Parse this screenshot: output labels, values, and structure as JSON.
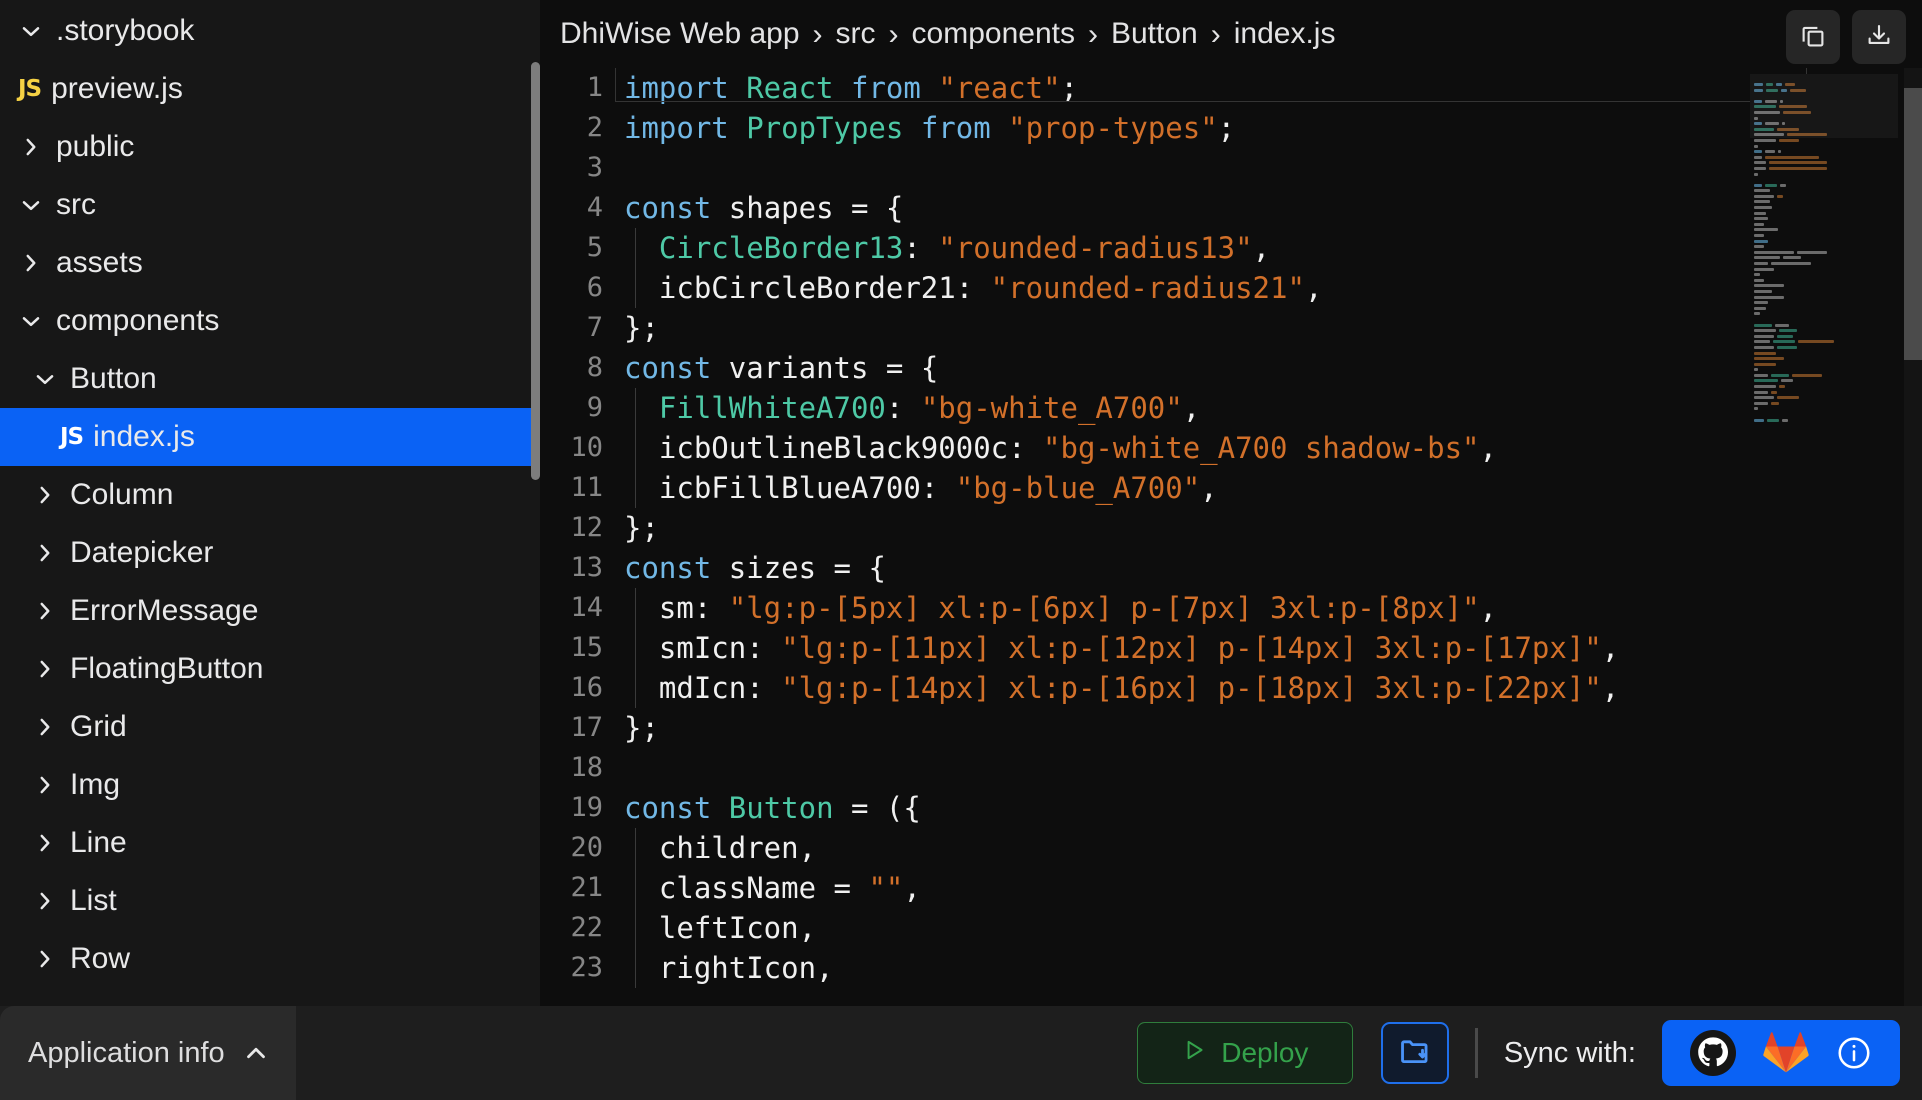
{
  "sidebar": {
    "items": [
      {
        "label": ".storybook",
        "icon": "chevron-down-icon",
        "indent": 0,
        "type": "folder",
        "selected": false
      },
      {
        "label": "preview.js",
        "icon": "js-file-icon",
        "indent": 1,
        "type": "file",
        "selected": false
      },
      {
        "label": "public",
        "icon": "chevron-right-icon",
        "indent": 0,
        "type": "folder",
        "selected": false
      },
      {
        "label": "src",
        "icon": "chevron-down-icon",
        "indent": 0,
        "type": "folder",
        "selected": false
      },
      {
        "label": "assets",
        "icon": "chevron-right-icon",
        "indent": 1,
        "type": "folder",
        "selected": false
      },
      {
        "label": "components",
        "icon": "chevron-down-icon",
        "indent": 1,
        "type": "folder",
        "selected": false
      },
      {
        "label": "Button",
        "icon": "chevron-down-icon",
        "indent": 2,
        "type": "folder",
        "selected": false
      },
      {
        "label": "index.js",
        "icon": "js-file-icon",
        "indent": 4,
        "type": "file",
        "selected": true
      },
      {
        "label": "Column",
        "icon": "chevron-right-icon",
        "indent": 2,
        "type": "folder",
        "selected": false
      },
      {
        "label": "Datepicker",
        "icon": "chevron-right-icon",
        "indent": 2,
        "type": "folder",
        "selected": false
      },
      {
        "label": "ErrorMessage",
        "icon": "chevron-right-icon",
        "indent": 2,
        "type": "folder",
        "selected": false
      },
      {
        "label": "FloatingButton",
        "icon": "chevron-right-icon",
        "indent": 2,
        "type": "folder",
        "selected": false
      },
      {
        "label": "Grid",
        "icon": "chevron-right-icon",
        "indent": 2,
        "type": "folder",
        "selected": false
      },
      {
        "label": "Img",
        "icon": "chevron-right-icon",
        "indent": 2,
        "type": "folder",
        "selected": false
      },
      {
        "label": "Line",
        "icon": "chevron-right-icon",
        "indent": 2,
        "type": "folder",
        "selected": false
      },
      {
        "label": "List",
        "icon": "chevron-right-icon",
        "indent": 2,
        "type": "folder",
        "selected": false
      },
      {
        "label": "Row",
        "icon": "chevron-right-icon",
        "indent": 2,
        "type": "folder",
        "selected": false
      }
    ],
    "selected_color": "#0a62f5",
    "js_badge_color": "#f5d144"
  },
  "header": {
    "breadcrumb": [
      "DhiWise Web app",
      "src",
      "components",
      "Button",
      "index.js"
    ],
    "separator": "›",
    "actions": [
      {
        "name": "copy-button",
        "icon": "copy-icon"
      },
      {
        "name": "download-button",
        "icon": "download-icon"
      }
    ]
  },
  "editor": {
    "current_line": 1,
    "first_visible_line": 1,
    "last_visible_line": 23,
    "lines": [
      {
        "n": "1",
        "tokens": [
          {
            "t": "import ",
            "c": "kw"
          },
          {
            "t": "React",
            "c": "id"
          },
          {
            "t": " ",
            "c": "pln"
          },
          {
            "t": "from",
            "c": "kw"
          },
          {
            "t": " ",
            "c": "pln"
          },
          {
            "t": "\"react\"",
            "c": "str"
          },
          {
            "t": ";",
            "c": "pun"
          }
        ]
      },
      {
        "n": "2",
        "tokens": [
          {
            "t": "import ",
            "c": "kw"
          },
          {
            "t": "PropTypes",
            "c": "id"
          },
          {
            "t": " ",
            "c": "pln"
          },
          {
            "t": "from",
            "c": "kw"
          },
          {
            "t": " ",
            "c": "pln"
          },
          {
            "t": "\"prop-types\"",
            "c": "str"
          },
          {
            "t": ";",
            "c": "pun"
          }
        ]
      },
      {
        "n": "3",
        "tokens": []
      },
      {
        "n": "4",
        "tokens": [
          {
            "t": "const",
            "c": "kw"
          },
          {
            "t": " shapes = {",
            "c": "pln"
          }
        ]
      },
      {
        "n": "5",
        "tokens": [
          {
            "t": "  ",
            "c": "pln"
          },
          {
            "t": "CircleBorder13",
            "c": "id"
          },
          {
            "t": ": ",
            "c": "pln"
          },
          {
            "t": "\"rounded-radius13\"",
            "c": "str"
          },
          {
            "t": ",",
            "c": "pun"
          }
        ],
        "guide": true
      },
      {
        "n": "6",
        "tokens": [
          {
            "t": "  icbCircleBorder21: ",
            "c": "pln"
          },
          {
            "t": "\"rounded-radius21\"",
            "c": "str"
          },
          {
            "t": ",",
            "c": "pun"
          }
        ],
        "guide": true
      },
      {
        "n": "7",
        "tokens": [
          {
            "t": "};",
            "c": "pln"
          }
        ]
      },
      {
        "n": "8",
        "tokens": [
          {
            "t": "const",
            "c": "kw"
          },
          {
            "t": " variants = {",
            "c": "pln"
          }
        ]
      },
      {
        "n": "9",
        "tokens": [
          {
            "t": "  ",
            "c": "pln"
          },
          {
            "t": "FillWhiteA700",
            "c": "id"
          },
          {
            "t": ": ",
            "c": "pln"
          },
          {
            "t": "\"bg-white_A700\"",
            "c": "str"
          },
          {
            "t": ",",
            "c": "pun"
          }
        ],
        "guide": true
      },
      {
        "n": "10",
        "tokens": [
          {
            "t": "  icbOutlineBlack9000c: ",
            "c": "pln"
          },
          {
            "t": "\"bg-white_A700 shadow-bs\"",
            "c": "str"
          },
          {
            "t": ",",
            "c": "pun"
          }
        ],
        "guide": true
      },
      {
        "n": "11",
        "tokens": [
          {
            "t": "  icbFillBlueA700: ",
            "c": "pln"
          },
          {
            "t": "\"bg-blue_A700\"",
            "c": "str"
          },
          {
            "t": ",",
            "c": "pun"
          }
        ],
        "guide": true
      },
      {
        "n": "12",
        "tokens": [
          {
            "t": "};",
            "c": "pln"
          }
        ]
      },
      {
        "n": "13",
        "tokens": [
          {
            "t": "const",
            "c": "kw"
          },
          {
            "t": " sizes = {",
            "c": "pln"
          }
        ]
      },
      {
        "n": "14",
        "tokens": [
          {
            "t": "  sm: ",
            "c": "pln"
          },
          {
            "t": "\"lg:p-[5px] xl:p-[6px] p-[7px] 3xl:p-[8px]\"",
            "c": "str"
          },
          {
            "t": ",",
            "c": "pun"
          }
        ],
        "guide": true
      },
      {
        "n": "15",
        "tokens": [
          {
            "t": "  smIcn: ",
            "c": "pln"
          },
          {
            "t": "\"lg:p-[11px] xl:p-[12px] p-[14px] 3xl:p-[17px]\"",
            "c": "str"
          },
          {
            "t": ",",
            "c": "pun"
          }
        ],
        "guide": true
      },
      {
        "n": "16",
        "tokens": [
          {
            "t": "  mdIcn: ",
            "c": "pln"
          },
          {
            "t": "\"lg:p-[14px] xl:p-[16px] p-[18px] 3xl:p-[22px]\"",
            "c": "str"
          },
          {
            "t": ",",
            "c": "pun"
          }
        ],
        "guide": true
      },
      {
        "n": "17",
        "tokens": [
          {
            "t": "};",
            "c": "pln"
          }
        ]
      },
      {
        "n": "18",
        "tokens": []
      },
      {
        "n": "19",
        "tokens": [
          {
            "t": "const",
            "c": "kw"
          },
          {
            "t": " ",
            "c": "pln"
          },
          {
            "t": "Button",
            "c": "id"
          },
          {
            "t": " = ({",
            "c": "pln"
          }
        ]
      },
      {
        "n": "20",
        "tokens": [
          {
            "t": "  children,",
            "c": "pln"
          }
        ],
        "guide": true
      },
      {
        "n": "21",
        "tokens": [
          {
            "t": "  className = ",
            "c": "pln"
          },
          {
            "t": "\"\"",
            "c": "str"
          },
          {
            "t": ",",
            "c": "pun"
          }
        ],
        "guide": true
      },
      {
        "n": "22",
        "tokens": [
          {
            "t": "  leftIcon,",
            "c": "pln"
          }
        ],
        "guide": true
      },
      {
        "n": "23",
        "tokens": [
          {
            "t": "  rightIcon,",
            "c": "pln"
          }
        ],
        "guide": true
      }
    ],
    "colors": {
      "background": "#0d0d0d",
      "keyword": "#72b8e6",
      "identifier": "#4ec9a6",
      "string": "#d2702a",
      "plain": "#f0f0f0",
      "line_number": "#868686"
    }
  },
  "minimap": {
    "label": "code-minimap",
    "rows": [
      [
        [
          "kw",
          9
        ],
        [
          "id",
          7
        ],
        [
          "kw",
          6
        ],
        [
          "str",
          10
        ]
      ],
      [
        [
          "kw",
          9
        ],
        [
          "id",
          12
        ],
        [
          "kw",
          6
        ],
        [
          "str",
          16
        ]
      ],
      [],
      [
        [
          "kw",
          8
        ],
        [
          "pln",
          12
        ],
        [
          "pln",
          3
        ]
      ],
      [
        [
          "id",
          22
        ],
        [
          "str",
          28
        ]
      ],
      [
        [
          "pln",
          26
        ],
        [
          "str",
          28
        ]
      ],
      [
        [
          "pln",
          4
        ]
      ],
      [
        [
          "kw",
          8
        ],
        [
          "pln",
          14
        ],
        [
          "pln",
          3
        ]
      ],
      [
        [
          "id",
          20
        ],
        [
          "str",
          22
        ]
      ],
      [
        [
          "pln",
          30
        ],
        [
          "str",
          40
        ]
      ],
      [
        [
          "pln",
          22
        ],
        [
          "str",
          20
        ]
      ],
      [
        [
          "pln",
          4
        ]
      ],
      [
        [
          "kw",
          8
        ],
        [
          "pln",
          10
        ],
        [
          "pln",
          3
        ]
      ],
      [
        [
          "pln",
          8
        ],
        [
          "str",
          54
        ]
      ],
      [
        [
          "pln",
          12
        ],
        [
          "str",
          58
        ]
      ],
      [
        [
          "pln",
          12
        ],
        [
          "str",
          58
        ]
      ],
      [
        [
          "pln",
          4
        ]
      ],
      [],
      [
        [
          "kw",
          8
        ],
        [
          "id",
          12
        ],
        [
          "pln",
          6
        ]
      ],
      [
        [
          "pln",
          16
        ]
      ],
      [
        [
          "pln",
          20
        ],
        [
          "str",
          6
        ]
      ],
      [
        [
          "pln",
          16
        ]
      ],
      [
        [
          "pln",
          18
        ]
      ],
      [
        [
          "pln",
          12
        ]
      ],
      [
        [
          "pln",
          14
        ]
      ],
      [
        [
          "pln",
          10
        ]
      ],
      [
        [
          "pln",
          24
        ]
      ],
      [
        [
          "pln",
          10
        ]
      ],
      [
        [
          "kw",
          14
        ]
      ],
      [
        [
          "pln",
          10
        ]
      ],
      [
        [
          "pln",
          40
        ],
        [
          "pln",
          30
        ]
      ],
      [
        [
          "pln",
          26
        ],
        [
          "pln",
          18
        ]
      ],
      [
        [
          "pln",
          14
        ],
        [
          "pln",
          40
        ]
      ],
      [
        [
          "pln",
          20
        ]
      ],
      [
        [
          "pln",
          6
        ]
      ],
      [
        [
          "pln",
          10
        ]
      ],
      [
        [
          "pln",
          30
        ]
      ],
      [
        [
          "pln",
          18
        ]
      ],
      [
        [
          "pln",
          30
        ]
      ],
      [
        [
          "pln",
          14
        ]
      ],
      [
        [
          "pln",
          12
        ]
      ],
      [
        [
          "pln",
          6
        ]
      ],
      [],
      [
        [
          "id",
          18
        ],
        [
          "pln",
          14
        ]
      ],
      [
        [
          "pln",
          22
        ],
        [
          "id",
          18
        ]
      ],
      [
        [
          "pln",
          20
        ],
        [
          "id",
          16
        ]
      ],
      [
        [
          "pln",
          16
        ],
        [
          "id",
          22
        ],
        [
          "str",
          36
        ]
      ],
      [
        [
          "pln",
          20
        ],
        [
          "id",
          20
        ]
      ],
      [
        [
          "str",
          22
        ]
      ],
      [
        [
          "str",
          30
        ]
      ],
      [
        [
          "str",
          22
        ]
      ],
      [
        [
          "pln",
          4
        ]
      ],
      [
        [
          "pln",
          14
        ],
        [
          "id",
          18
        ],
        [
          "str",
          30
        ]
      ],
      [
        [
          "id",
          24
        ],
        [
          "pln",
          12
        ]
      ],
      [
        [
          "pln",
          22
        ],
        [
          "str",
          6
        ]
      ],
      [
        [
          "pln",
          14
        ],
        [
          "str",
          6
        ]
      ],
      [
        [
          "pln",
          20
        ],
        [
          "str",
          22
        ]
      ],
      [
        [
          "pln",
          14
        ],
        [
          "str",
          8
        ]
      ],
      [
        [
          "pln",
          4
        ]
      ],
      [],
      [
        [
          "kw",
          10
        ],
        [
          "id",
          12
        ],
        [
          "pln",
          6
        ]
      ]
    ]
  },
  "bottombar": {
    "app_info_label": "Application info",
    "app_info_caret": "chevron-up-icon",
    "deploy_label": "Deploy",
    "deploy_icon": "play-icon",
    "deploy_color": "#34a24b",
    "folder_button_icon": "folder-download-icon",
    "folder_button_color": "#1f6feb",
    "sync_label": "Sync with:",
    "sync_panel_color": "#0a62f5",
    "sync_icons": [
      {
        "name": "github-icon"
      },
      {
        "name": "gitlab-icon"
      },
      {
        "name": "info-icon"
      }
    ]
  }
}
